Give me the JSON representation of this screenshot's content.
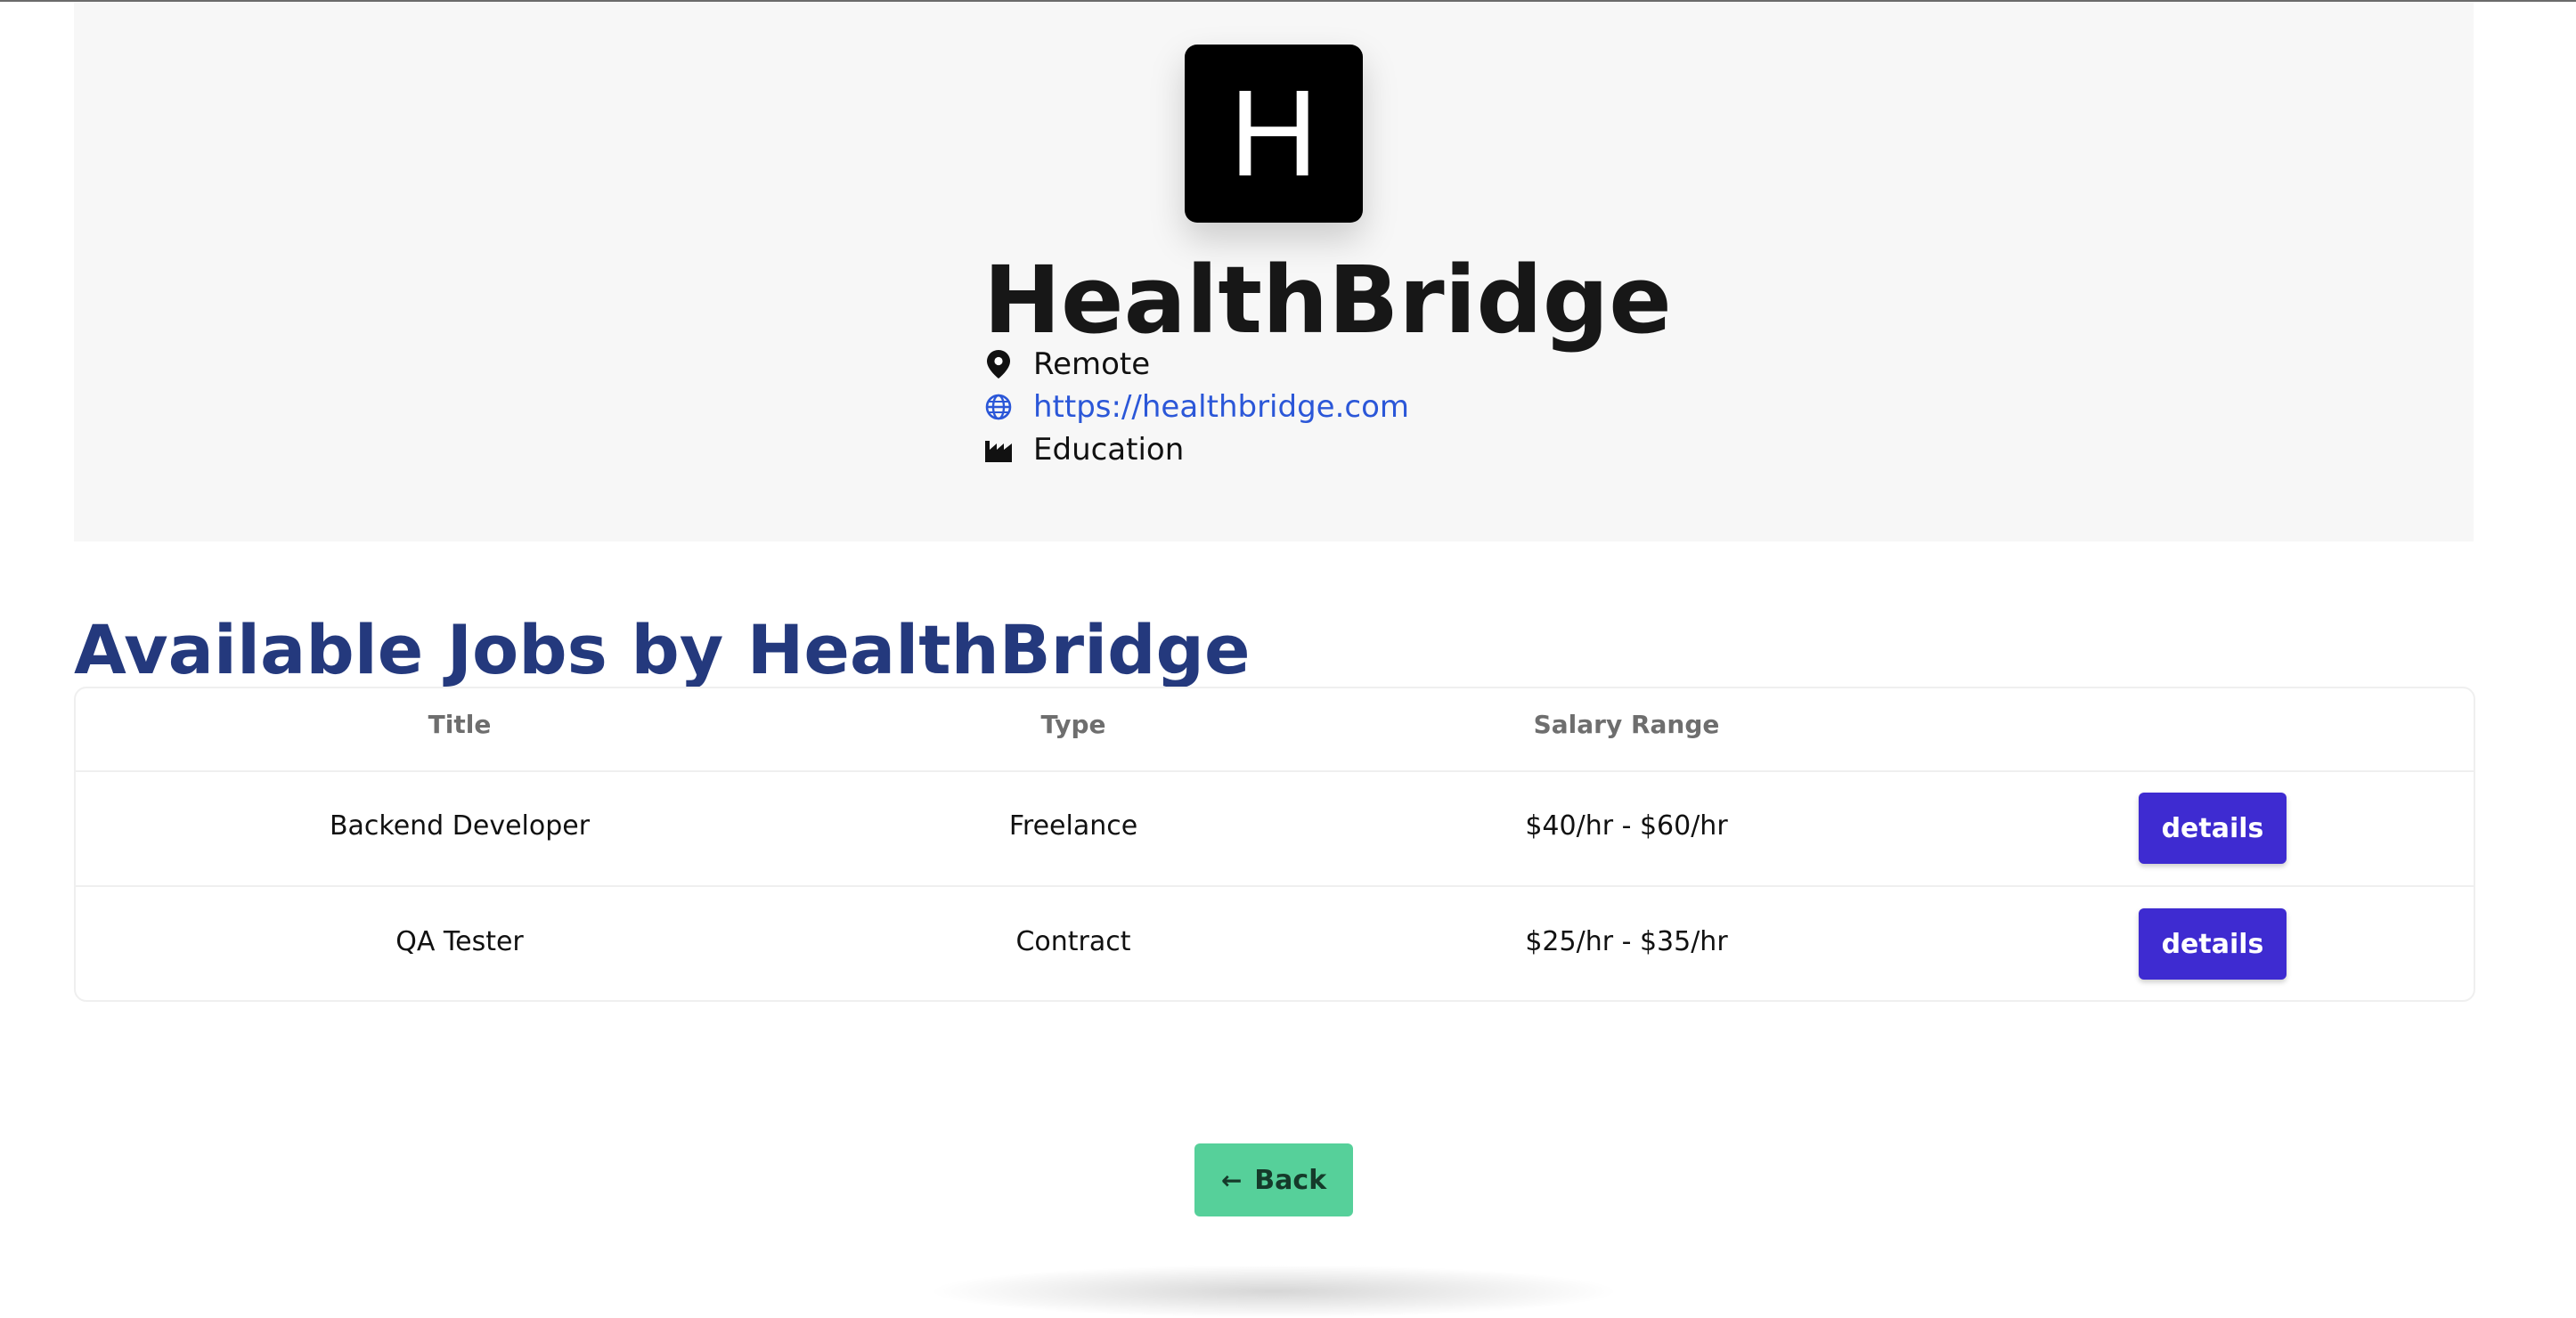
{
  "company": {
    "logo_letter": "H",
    "name": "HealthBridge",
    "location": "Remote",
    "website": "https://healthbridge.com",
    "industry": "Education"
  },
  "jobs_section": {
    "title": "Available Jobs by HealthBridge",
    "columns": [
      "Title",
      "Type",
      "Salary Range",
      ""
    ],
    "rows": [
      {
        "title": "Backend Developer",
        "type": "Freelance",
        "salary": "$40/hr - $60/hr",
        "action": "details"
      },
      {
        "title": "QA Tester",
        "type": "Contract",
        "salary": "$25/hr - $35/hr",
        "action": "details"
      }
    ]
  },
  "back_button": {
    "label": "Back",
    "icon": "arrow-left-icon"
  },
  "icons": {
    "location": "map-pin-icon",
    "website": "globe-icon",
    "industry": "factory-icon"
  },
  "colors": {
    "primary_button": "#3e2bd1",
    "back_button": "#56d09a",
    "section_title": "#24397d",
    "link": "#2b57d8"
  }
}
